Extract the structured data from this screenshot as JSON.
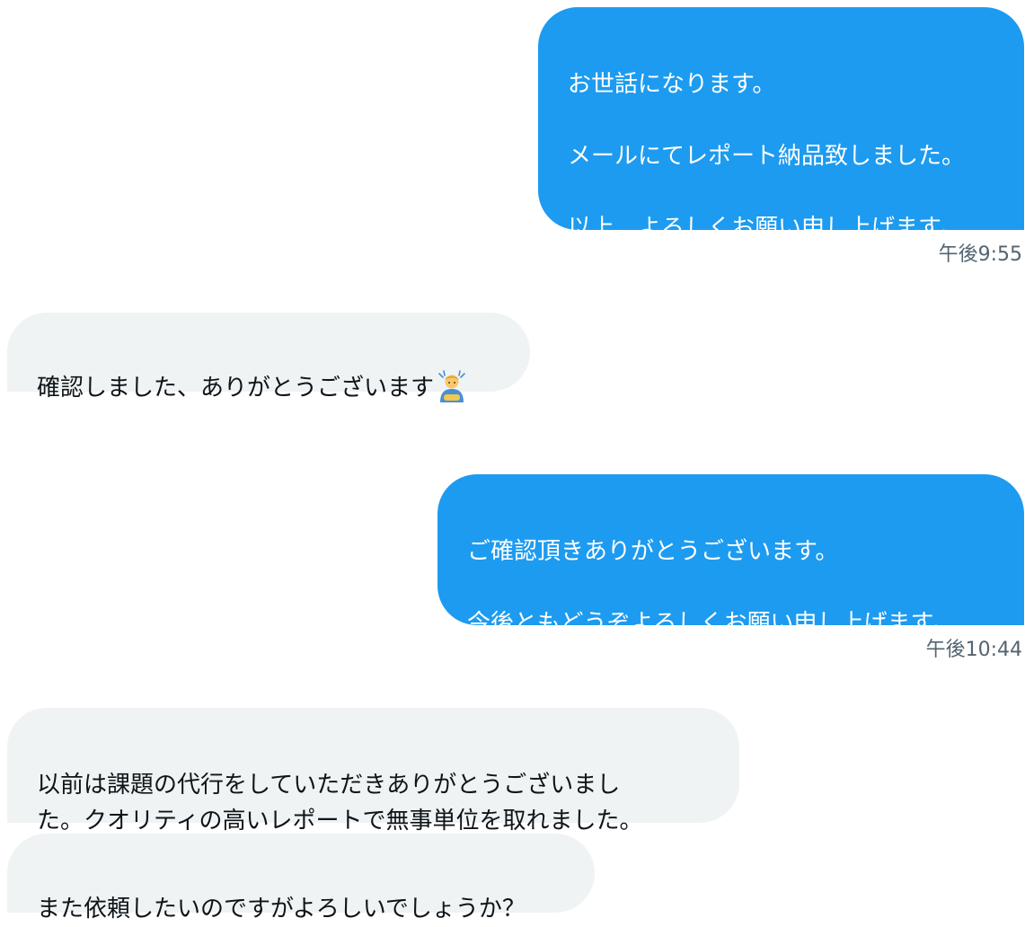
{
  "conversation": {
    "messages": [
      {
        "sender": "me",
        "text": "お世話になります。\n\nメールにてレポート納品致しました。\n\n以上、よろしくお願い申し上げます。"
      },
      {
        "sender": "other",
        "text": "確認しました、ありがとうございます",
        "emoji": "person-bowing-emoji"
      },
      {
        "sender": "me",
        "text": "ご確認頂きありがとうございます。\n\n今後ともどうぞよろしくお願い申し上げます。"
      },
      {
        "sender": "other",
        "text": "以前は課題の代行をしていただきありがとうございまし\nた。クオリティの高いレポートで無事単位を取れました。"
      },
      {
        "sender": "other",
        "text": "また依頼したいのですがよろしいでしょうか？"
      }
    ],
    "timestamps": [
      "午後9:55",
      "午後10:44"
    ]
  },
  "colors": {
    "sent_bubble": "#1d9bf0",
    "received_bubble": "#eff3f4",
    "timestamp": "#536471"
  }
}
